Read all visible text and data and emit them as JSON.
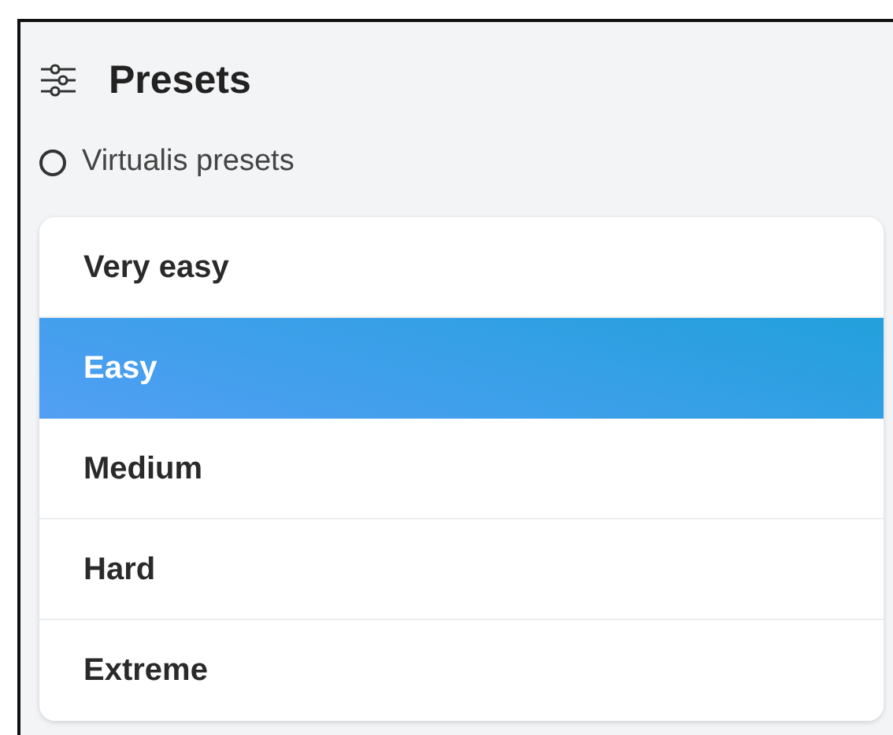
{
  "header": {
    "title": "Presets"
  },
  "source_option": {
    "label": "Virtualis presets",
    "checked": false
  },
  "presets": [
    {
      "label": "Very easy",
      "selected": false
    },
    {
      "label": "Easy",
      "selected": true
    },
    {
      "label": "Medium",
      "selected": false
    },
    {
      "label": "Hard",
      "selected": false
    },
    {
      "label": "Extreme",
      "selected": false
    }
  ]
}
